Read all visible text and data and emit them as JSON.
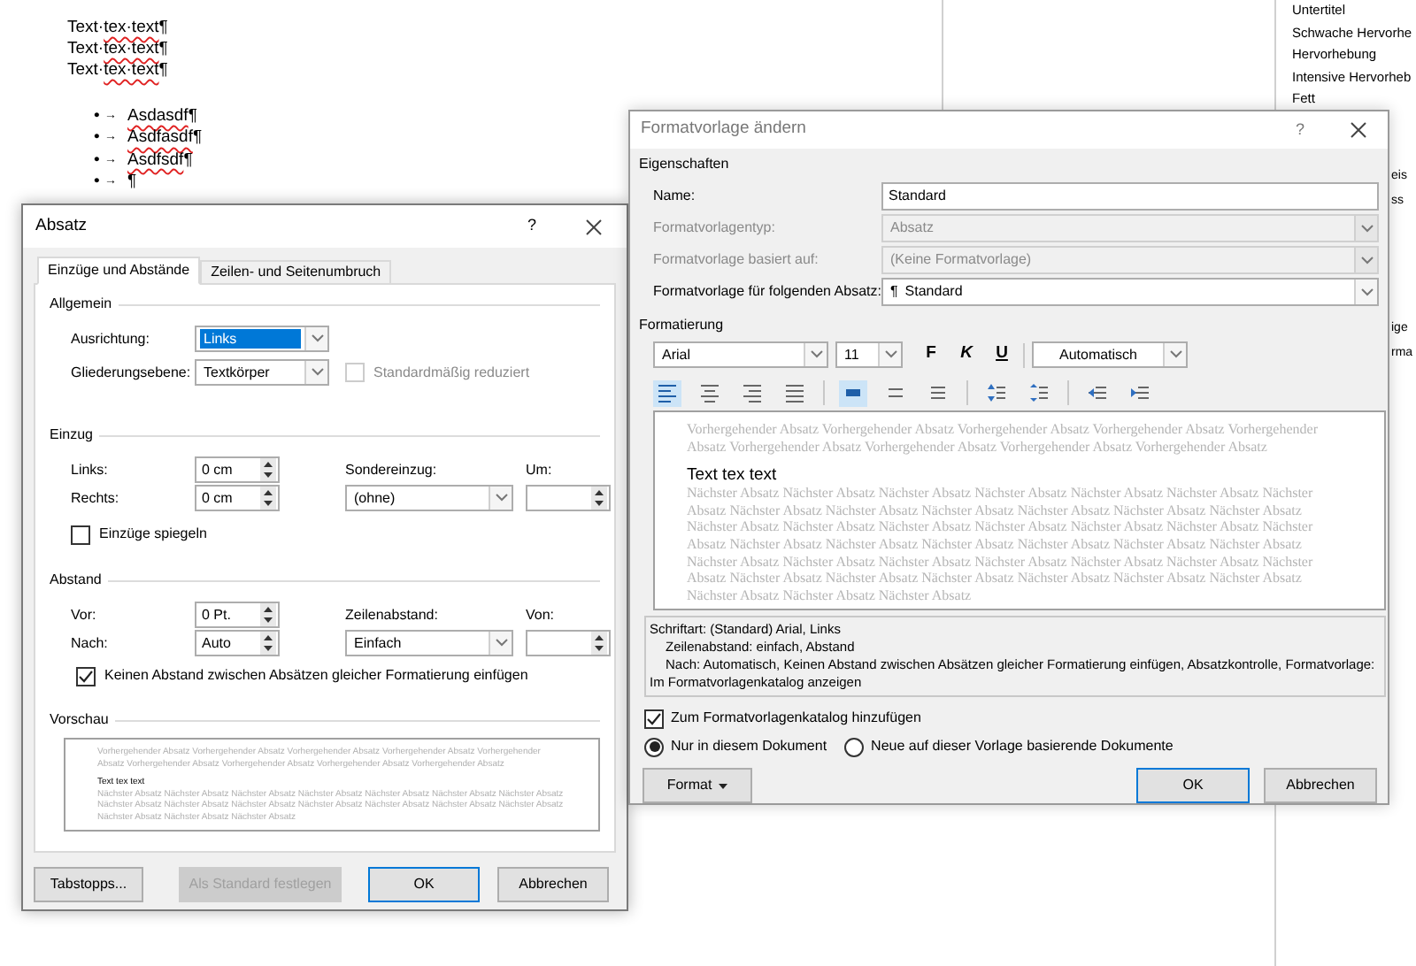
{
  "document": {
    "lines": [
      {
        "segments": [
          {
            "text": "Text·",
            "misspelled": false
          },
          {
            "text": "tex·text",
            "misspelled": true
          },
          {
            "text": "¶",
            "misspelled": false
          }
        ]
      },
      {
        "segments": [
          {
            "text": "Text·",
            "misspelled": false
          },
          {
            "text": "tex·text",
            "misspelled": true
          },
          {
            "text": "¶",
            "misspelled": false
          }
        ]
      },
      {
        "segments": [
          {
            "text": "Text·",
            "misspelled": false
          },
          {
            "text": "tex·text",
            "misspelled": true
          },
          {
            "text": "¶",
            "misspelled": false
          }
        ]
      }
    ],
    "bullets": [
      {
        "bullet": "•",
        "tab": "→",
        "segments": [
          {
            "text": "Asdasdf",
            "misspelled": true
          },
          {
            "text": "¶",
            "misspelled": false
          }
        ]
      },
      {
        "bullet": "•",
        "tab": "→",
        "segments": [
          {
            "text": "Asdfasdf",
            "misspelled": true
          },
          {
            "text": "¶",
            "misspelled": false
          }
        ]
      },
      {
        "bullet": "•",
        "tab": "→",
        "segments": [
          {
            "text": "Asdfsdf",
            "misspelled": true
          },
          {
            "text": "¶",
            "misspelled": false
          }
        ]
      },
      {
        "bullet": "•",
        "tab": "→",
        "segments": [
          {
            "text": "¶",
            "misspelled": false
          }
        ]
      }
    ]
  },
  "style_pane": {
    "items": [
      "Untertitel",
      "Schwache Hervorhe",
      "Hervorhebung",
      "Intensive Hervorheb",
      "Fett"
    ],
    "fragments_upper": [
      "eis",
      "ss"
    ],
    "fragments_lower": [
      "ige",
      "rma"
    ]
  },
  "paragraph_dialog": {
    "title": "Absatz",
    "help": "?",
    "tabs": [
      {
        "label": "Einzüge und Abstände",
        "selected": true
      },
      {
        "label": "Zeilen- und Seitenumbruch",
        "selected": false
      }
    ],
    "general": {
      "heading": "Allgemein",
      "alignment": {
        "label": "Ausrichtung:",
        "value": "Links",
        "highlighted": true
      },
      "outline": {
        "label": "Gliederungsebene:",
        "value": "Textkörper"
      },
      "collapsed": {
        "label": "Standardmäßig reduziert",
        "checked": false,
        "disabled": true
      }
    },
    "indent": {
      "heading": "Einzug",
      "left": {
        "label": "Links:",
        "value": "0 cm"
      },
      "right": {
        "label": "Rechts:",
        "value": "0 cm"
      },
      "special": {
        "label": "Sondereinzug:",
        "value": "(ohne)"
      },
      "by": {
        "label": "Um:"
      },
      "mirror": {
        "label": "Einzüge spiegeln",
        "checked": false,
        "disabled": false
      }
    },
    "spacing": {
      "heading": "Abstand",
      "before": {
        "label": "Vor:",
        "value": "0 Pt."
      },
      "after": {
        "label": "Nach:",
        "value": "Auto"
      },
      "line": {
        "label": "Zeilenabstand:",
        "value": "Einfach"
      },
      "at": {
        "label": "Von:"
      },
      "no_space": {
        "label": "Keinen Abstand zwischen Absätzen gleicher Formatierung einfügen",
        "checked": true,
        "disabled": false
      }
    },
    "preview": {
      "heading": "Vorschau",
      "previous": "Vorhergehender Absatz Vorhergehender Absatz Vorhergehender Absatz Vorhergehender Absatz Vorhergehender Absatz Vorhergehender Absatz Vorhergehender Absatz Vorhergehender Absatz Vorhergehender Absatz",
      "sample": "Text tex text",
      "next": "Nächster Absatz Nächster Absatz Nächster Absatz Nächster Absatz Nächster Absatz Nächster Absatz Nächster Absatz Nächster Absatz Nächster Absatz Nächster Absatz Nächster Absatz Nächster Absatz Nächster Absatz Nächster Absatz Nächster Absatz Nächster Absatz Nächster Absatz"
    },
    "buttons": [
      {
        "label": "Tabstopps...",
        "disabled": false,
        "default": false
      },
      {
        "label": "Als Standard festlegen",
        "disabled": true,
        "default": false
      },
      {
        "label": "OK",
        "disabled": false,
        "default": true
      },
      {
        "label": "Abbrechen",
        "disabled": false,
        "default": false
      }
    ]
  },
  "style_dialog": {
    "title": "Formatvorlage ändern",
    "help": "?",
    "properties": {
      "heading": "Eigenschaften",
      "fields": [
        {
          "label": "Name:",
          "value": "Standard",
          "kind": "text",
          "disabled": false
        },
        {
          "label": "Formatvorlagentyp:",
          "value": "Absatz",
          "kind": "combo",
          "disabled": true
        },
        {
          "label": "Formatvorlage basiert auf:",
          "value": "(Keine Formatvorlage)",
          "kind": "combo",
          "disabled": true
        },
        {
          "label": "Formatvorlage für folgenden Absatz:",
          "value": "Standard",
          "icon": "¶",
          "kind": "combo",
          "disabled": false
        }
      ]
    },
    "formatting": {
      "heading": "Formatierung",
      "font": "Arial",
      "size": "11",
      "styles": [
        {
          "label": "F",
          "kind": "bold",
          "selected": false
        },
        {
          "label": "K",
          "kind": "italic",
          "selected": false
        },
        {
          "label": "U",
          "kind": "underline",
          "selected": false
        }
      ],
      "font_color_label": "Automatisch",
      "paragraph_buttons": [
        {
          "selected": true
        },
        {
          "selected": false
        },
        {
          "selected": false
        },
        {
          "selected": false
        },
        {
          "selected": true
        },
        {
          "selected": false
        },
        {
          "selected": false
        },
        {
          "selected": false
        },
        {
          "selected": false
        },
        {
          "selected": false
        },
        {
          "selected": false
        }
      ]
    },
    "preview": {
      "previous": "Vorhergehender Absatz Vorhergehender Absatz Vorhergehender Absatz Vorhergehender Absatz Vorhergehender Absatz Vorhergehender Absatz Vorhergehender Absatz Vorhergehender Absatz Vorhergehender Absatz",
      "sample": "Text tex text",
      "next": "Nächster Absatz Nächster Absatz Nächster Absatz Nächster Absatz Nächster Absatz Nächster Absatz Nächster Absatz Nächster Absatz Nächster Absatz Nächster Absatz Nächster Absatz Nächster Absatz Nächster Absatz Nächster Absatz Nächster Absatz Nächster Absatz Nächster Absatz Nächster Absatz Nächster Absatz Nächster Absatz Nächster Absatz Nächster Absatz Nächster Absatz Nächster Absatz Nächster Absatz Nächster Absatz Nächster Absatz Nächster Absatz Nächster Absatz Nächster Absatz Nächster Absatz Nächster Absatz Nächster Absatz Nächster Absatz Nächster Absatz Nächster Absatz Nächster Absatz Nächster Absatz Nächster Absatz Nächster Absatz Nächster Absatz Nächster Absatz"
    },
    "description": [
      {
        "text": "Schriftart: (Standard) Arial, Links",
        "indented": false
      },
      {
        "text": "Zeilenabstand: einfach, Abstand",
        "indented": true
      },
      {
        "text": "Nach: Automatisch, Keinen Abstand zwischen Absätzen gleicher Formatierung einfügen, Absatzkontrolle, Formatvorlage:",
        "indented": true
      },
      {
        "text": "Im Formatvorlagenkatalog anzeigen",
        "indented": false
      }
    ],
    "add_to_gallery": {
      "label": "Zum Formatvorlagenkatalog hinzufügen",
      "checked": true
    },
    "scope": [
      {
        "label": "Nur in diesem Dokument",
        "selected": true
      },
      {
        "label": "Neue auf dieser Vorlage basierende Dokumente",
        "selected": false
      }
    ],
    "buttons": [
      {
        "label": "Format",
        "kind": "menu",
        "default": false
      },
      {
        "label": "OK",
        "kind": "plain",
        "default": true
      },
      {
        "label": "Abbrechen",
        "kind": "plain",
        "default": false
      }
    ]
  }
}
